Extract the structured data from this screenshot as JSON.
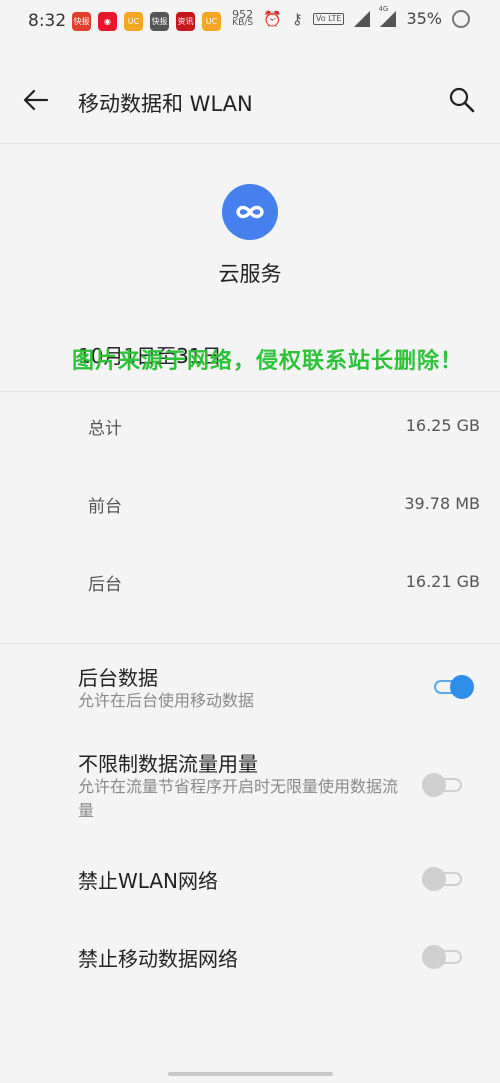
{
  "status_bar": {
    "time": "8:32",
    "apps": [
      {
        "name": "kuaibao-app-icon",
        "text": "快报",
        "color": "#e2402e"
      },
      {
        "name": "weibo-app-icon",
        "text": "◉",
        "color": "#e6162d"
      },
      {
        "name": "uc-browser-app-icon",
        "text": "UC",
        "color": "#f5a623"
      },
      {
        "name": "kuaibao-app-icon-2",
        "text": "快报",
        "color": "#555555"
      },
      {
        "name": "news-app-icon",
        "text": "资讯",
        "color": "#c8161d"
      },
      {
        "name": "uc-browser-app-icon-2",
        "text": "UC",
        "color": "#f5a623"
      }
    ],
    "net_speed": "952",
    "net_unit": "KB/S",
    "volte": "Vo LTE",
    "network_type": "4G",
    "battery": "35%"
  },
  "app_bar": {
    "title": "移动数据和 WLAN"
  },
  "app_info": {
    "name": "云服务",
    "icon": "cloud-infinity-icon",
    "accent": "#4680ed"
  },
  "date_range": "10月1日至31日",
  "watermark": "图片来源于网络，侵权联系站长删除！",
  "usage": [
    {
      "label": "总计",
      "value": "16.25 GB"
    },
    {
      "label": "前台",
      "value": "39.78 MB"
    },
    {
      "label": "后台",
      "value": "16.21 GB"
    }
  ],
  "settings": [
    {
      "title": "后台数据",
      "subtitle": "允许在后台使用移动数据",
      "enabled": true
    },
    {
      "title": "不限制数据流量用量",
      "subtitle": "允许在流量节省程序开启时无限量使用数据流量",
      "enabled": false
    },
    {
      "title": "禁止WLAN网络",
      "subtitle": "",
      "enabled": false
    },
    {
      "title": "禁止移动数据网络",
      "subtitle": "",
      "enabled": false
    }
  ],
  "colors": {
    "toggle_on": "#2f8fe8",
    "toggle_off": "#cfcfcf",
    "watermark": "#2ec23a"
  }
}
